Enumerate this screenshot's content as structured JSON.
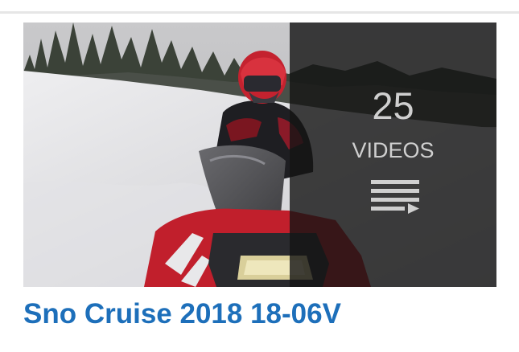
{
  "playlist": {
    "video_count": "25",
    "video_count_label": "VIDEOS",
    "title": "Sno Cruise 2018 18-06V",
    "overlay_icon": "playlist-icon"
  },
  "colors": {
    "title": "#1d6fba",
    "overlay_text": "#cfcfcf"
  }
}
